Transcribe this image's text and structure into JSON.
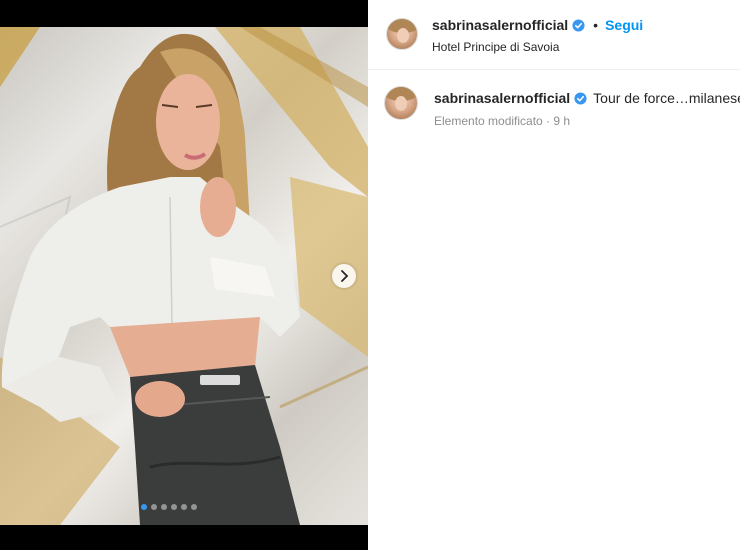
{
  "post": {
    "username": "sabrinasalernofficial",
    "verified": true,
    "follow_label": "Segui",
    "separator": "•",
    "location": "Hotel Principe di Savoia",
    "caption": "Tour de force…milanese …",
    "meta": "Elemento modificato · 9 h"
  },
  "carousel": {
    "total_slides": 6,
    "active_index": 0,
    "next_icon": "chevron-right-icon"
  },
  "colors": {
    "follow_blue": "#0095f6",
    "verified_blue": "#3897f0",
    "text": "#262626",
    "muted": "#8e8e8e"
  }
}
